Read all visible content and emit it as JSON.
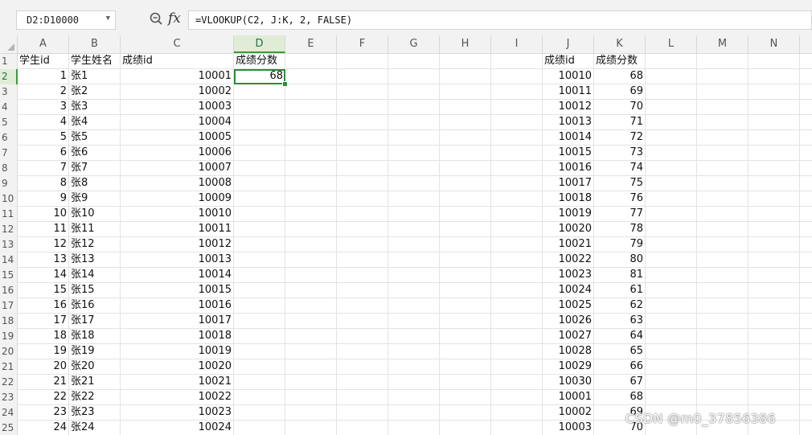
{
  "formula_bar": {
    "name_box": "D2:D10000",
    "fx_label": "fx",
    "formula": "=VLOOKUP(C2, J:K, 2, FALSE)"
  },
  "columns": [
    "A",
    "B",
    "C",
    "D",
    "E",
    "F",
    "G",
    "H",
    "I",
    "J",
    "K",
    "L",
    "M",
    "N"
  ],
  "active_column": "D",
  "active_row": "2",
  "headers": {
    "A": "学生id",
    "B": "学生姓名",
    "C": "成绩id",
    "D": "成绩分数",
    "J": "成绩id",
    "K": "成绩分数"
  },
  "rows": [
    {
      "n": "2",
      "a": "1",
      "b": "张1",
      "c": "10001",
      "d": "68",
      "j": "10010",
      "k": "68"
    },
    {
      "n": "3",
      "a": "2",
      "b": "张2",
      "c": "10002",
      "d": "",
      "j": "10011",
      "k": "69"
    },
    {
      "n": "4",
      "a": "3",
      "b": "张3",
      "c": "10003",
      "d": "",
      "j": "10012",
      "k": "70"
    },
    {
      "n": "5",
      "a": "4",
      "b": "张4",
      "c": "10004",
      "d": "",
      "j": "10013",
      "k": "71"
    },
    {
      "n": "6",
      "a": "5",
      "b": "张5",
      "c": "10005",
      "d": "",
      "j": "10014",
      "k": "72"
    },
    {
      "n": "7",
      "a": "6",
      "b": "张6",
      "c": "10006",
      "d": "",
      "j": "10015",
      "k": "73"
    },
    {
      "n": "8",
      "a": "7",
      "b": "张7",
      "c": "10007",
      "d": "",
      "j": "10016",
      "k": "74"
    },
    {
      "n": "9",
      "a": "8",
      "b": "张8",
      "c": "10008",
      "d": "",
      "j": "10017",
      "k": "75"
    },
    {
      "n": "10",
      "a": "9",
      "b": "张9",
      "c": "10009",
      "d": "",
      "j": "10018",
      "k": "76"
    },
    {
      "n": "11",
      "a": "10",
      "b": "张10",
      "c": "10010",
      "d": "",
      "j": "10019",
      "k": "77"
    },
    {
      "n": "12",
      "a": "11",
      "b": "张11",
      "c": "10011",
      "d": "",
      "j": "10020",
      "k": "78"
    },
    {
      "n": "13",
      "a": "12",
      "b": "张12",
      "c": "10012",
      "d": "",
      "j": "10021",
      "k": "79"
    },
    {
      "n": "14",
      "a": "13",
      "b": "张13",
      "c": "10013",
      "d": "",
      "j": "10022",
      "k": "80"
    },
    {
      "n": "15",
      "a": "14",
      "b": "张14",
      "c": "10014",
      "d": "",
      "j": "10023",
      "k": "81"
    },
    {
      "n": "16",
      "a": "15",
      "b": "张15",
      "c": "10015",
      "d": "",
      "j": "10024",
      "k": "61"
    },
    {
      "n": "17",
      "a": "16",
      "b": "张16",
      "c": "10016",
      "d": "",
      "j": "10025",
      "k": "62"
    },
    {
      "n": "18",
      "a": "17",
      "b": "张17",
      "c": "10017",
      "d": "",
      "j": "10026",
      "k": "63"
    },
    {
      "n": "19",
      "a": "18",
      "b": "张18",
      "c": "10018",
      "d": "",
      "j": "10027",
      "k": "64"
    },
    {
      "n": "20",
      "a": "19",
      "b": "张19",
      "c": "10019",
      "d": "",
      "j": "10028",
      "k": "65"
    },
    {
      "n": "21",
      "a": "20",
      "b": "张20",
      "c": "10020",
      "d": "",
      "j": "10029",
      "k": "66"
    },
    {
      "n": "22",
      "a": "21",
      "b": "张21",
      "c": "10021",
      "d": "",
      "j": "10030",
      "k": "67"
    },
    {
      "n": "23",
      "a": "22",
      "b": "张22",
      "c": "10022",
      "d": "",
      "j": "10001",
      "k": "68"
    },
    {
      "n": "24",
      "a": "23",
      "b": "张23",
      "c": "10023",
      "d": "",
      "j": "10002",
      "k": "69"
    },
    {
      "n": "25",
      "a": "24",
      "b": "张24",
      "c": "10024",
      "d": "",
      "j": "10003",
      "k": "70"
    }
  ],
  "watermark": "CSDN @m0_37856386",
  "colors": {
    "accent": "#217346",
    "selection": "#2e8b3a"
  }
}
